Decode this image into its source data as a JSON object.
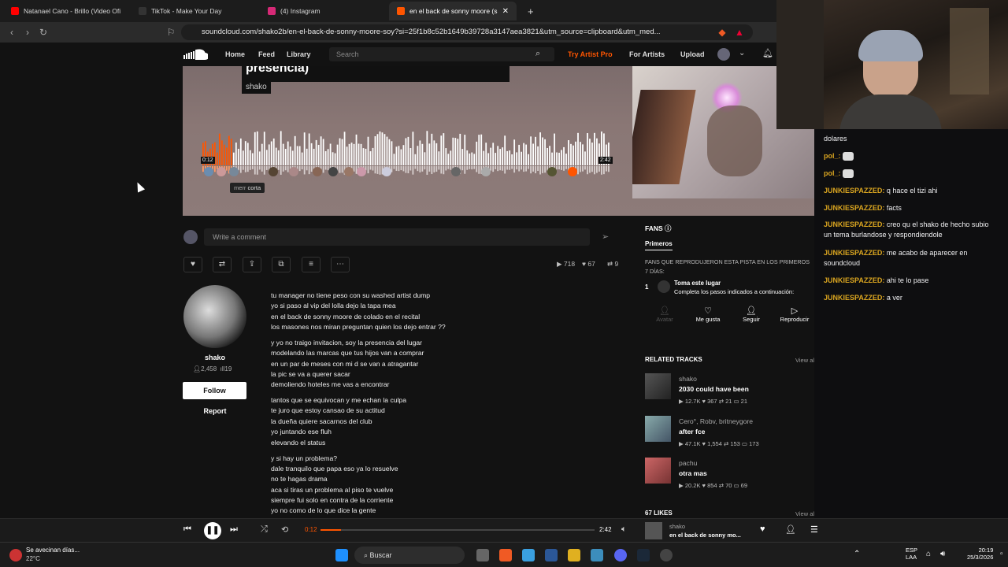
{
  "browser": {
    "tabs": [
      {
        "label": "Natanael Cano - Brillo (Video Ofi",
        "color": "#ff0000"
      },
      {
        "label": "TikTok - Make Your Day",
        "color": "#111111"
      },
      {
        "label": "(4) Instagram",
        "color": "#d62976"
      },
      {
        "label": "en el back de sonny moore (s",
        "color": "#ff5500"
      }
    ],
    "url": "soundcloud.com/shako2b/en-el-back-de-sonny-moore-soy?si=25f1b8c52b1649b39728a3147aea3821&utm_source=clipboard&utm_med..."
  },
  "sc_nav": {
    "home": "Home",
    "feed": "Feed",
    "library": "Library",
    "search_placeholder": "Search",
    "try_pro": "Try Artist Pro",
    "for_artists": "For Artists",
    "upload": "Upload"
  },
  "hero": {
    "title_fragment": "presencia)",
    "artist": "shako",
    "time_current": "0:12",
    "time_total": "2:42",
    "tooltip_user": "merr",
    "tooltip_text": "corta",
    "progress": 0.074
  },
  "comment": {
    "placeholder": "Write a comment"
  },
  "stats": {
    "plays": "718",
    "likes": "67",
    "reposts": "9"
  },
  "artist": {
    "name": "shako",
    "followers": "2,458",
    "tracks": "19",
    "follow_label": "Follow",
    "report_label": "Report"
  },
  "lyrics": [
    "tu manager no tiene peso con su washed artist dump",
    "yo si paso al vip del lolla dejo la tapa mea",
    "en el back de sonny moore de colado en el recital",
    "los masones nos miran preguntan quien los dejo entrar ??",
    "y yo no traigo invitacion, soy la presencia del lugar",
    "modelando las marcas que tus hijos van a comprar",
    "en un par de meses con mi d se van a atragantar",
    "la pic se va a querer sacar",
    "demoliendo hoteles me vas a encontrar",
    "tantos que se equivocan y me echan la culpa",
    "te juro que estoy cansao de su actitud",
    "la dueña quiere sacarnos del club",
    "yo juntando ese fluh",
    "elevando el status",
    "y si hay un problema?",
    "dale tranquilo que papa eso ya lo resuelve",
    "no te hagas drama",
    "aca si tiras un problema al piso te vuelve",
    "siempre fui solo en contra de la corriente",
    "yo no como de lo que dice la gente"
  ],
  "fans": {
    "heading": "FANS",
    "tab": "Primeros",
    "description": "FANS QUE REPRODUJERON ESTA PISTA EN LOS PRIMEROS 7 DÍAS:",
    "rank": "1",
    "claim_title": "Toma este lugar",
    "claim_sub": "Completa los pasos indicados a continuación:",
    "steps": [
      "Avatar",
      "Me gusta",
      "Seguir",
      "Reproducir"
    ]
  },
  "related": {
    "heading": "RELATED TRACKS",
    "view_all": "View all",
    "tracks": [
      {
        "artist": "shako",
        "title": "2030 could have been",
        "plays": "12.7K",
        "likes": "367",
        "reposts": "21",
        "comments": "21"
      },
      {
        "artist": "Cero°, Robv, britneygore",
        "title": "after fce",
        "plays": "47.1K",
        "likes": "1,554",
        "reposts": "153",
        "comments": "173"
      },
      {
        "artist": "pachu",
        "title": "otra mas",
        "plays": "20.2K",
        "likes": "854",
        "reposts": "70",
        "comments": "69"
      }
    ],
    "likes_heading": "67 LIKES",
    "likes_view_all": "View all"
  },
  "chat": [
    {
      "user": "",
      "text": "dolares",
      "color": "#efeff1"
    },
    {
      "user": "pol_:",
      "text": "",
      "color": "#daa520"
    },
    {
      "user": "pol_:",
      "text": "",
      "color": "#daa520"
    },
    {
      "user": "JUNKIESPAZZED:",
      "text": "q hace el tizi ahi",
      "color": "#daa520"
    },
    {
      "user": "JUNKIESPAZZED:",
      "text": "facts",
      "color": "#daa520"
    },
    {
      "user": "JUNKIESPAZZED:",
      "text": "creo qu el shako de hecho subio un tema burlandose y respondiendole",
      "color": "#daa520"
    },
    {
      "user": "JUNKIESPAZZED:",
      "text": "me acabo de aparecer en soundcloud",
      "color": "#daa520"
    },
    {
      "user": "JUNKIESPAZZED:",
      "text": "ahi te lo pase",
      "color": "#daa520"
    },
    {
      "user": "JUNKIESPAZZED:",
      "text": "a ver",
      "color": "#daa520"
    }
  ],
  "player": {
    "current": "0:12",
    "total": "2:42",
    "progress": 0.074,
    "track_artist": "shako",
    "track_title": "en el back de sonny mo..."
  },
  "taskbar": {
    "weather_text": "Se avecinan días...",
    "weather_temp": "22°C",
    "search": "Buscar",
    "lang1": "ESP",
    "lang2": "LAA",
    "time": "20:19",
    "date": "25/3/2026"
  },
  "colors": {
    "accent": "#ff5500",
    "chat_user": "#daa520"
  }
}
